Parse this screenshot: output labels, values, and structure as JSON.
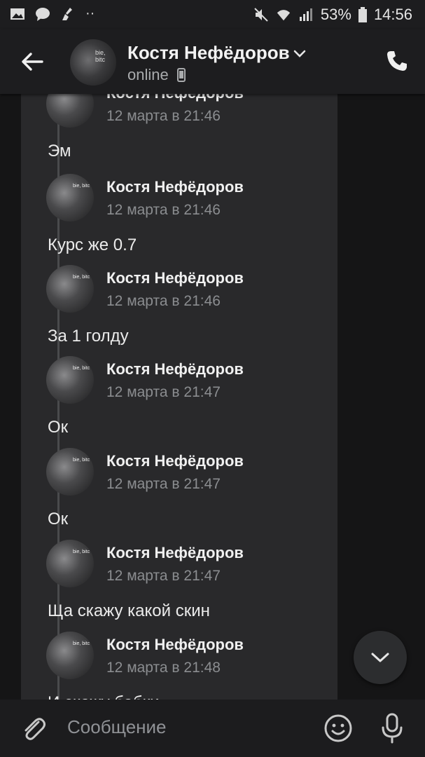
{
  "status_bar": {
    "battery": "53%",
    "time": "14:56"
  },
  "header": {
    "name": "Костя Нефёдоров",
    "status": "online",
    "avatar_text": "bie, bitc"
  },
  "messages": [
    {
      "name": "Костя Нефёдоров",
      "time": "12 марта в 21:46",
      "text": "Эм"
    },
    {
      "name": "Костя Нефёдоров",
      "time": "12 марта в 21:46",
      "text": "Курс же 0.7"
    },
    {
      "name": "Костя Нефёдоров",
      "time": "12 марта в 21:46",
      "text": "За 1 голду"
    },
    {
      "name": "Костя Нефёдоров",
      "time": "12 марта в 21:47",
      "text": "Ок"
    },
    {
      "name": "Костя Нефёдоров",
      "time": "12 марта в 21:47",
      "text": "Ок"
    },
    {
      "name": "Костя Нефёдоров",
      "time": "12 марта в 21:47",
      "text": "Ща скажу какой скин"
    },
    {
      "name": "Костя Нефёдоров",
      "time": "12 марта в 21:48",
      "text": "И скажу бабки"
    }
  ],
  "composer": {
    "placeholder": "Сообщение"
  },
  "colors": {
    "background": "#151516",
    "card": "#29292b",
    "header": "#1d1d1f",
    "muted": "#8b8d90"
  }
}
